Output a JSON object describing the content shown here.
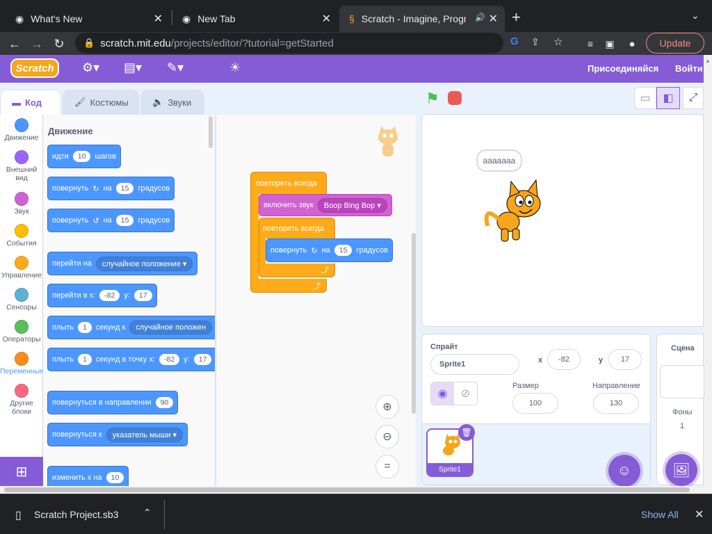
{
  "browser": {
    "tabs": [
      {
        "title": "What's New"
      },
      {
        "title": "New Tab"
      },
      {
        "title": "Scratch - Imagine, Program"
      }
    ],
    "url_host": "scratch.mit.edu",
    "url_path": "/projects/editor/?tutorial=getStarted",
    "update_label": "Update"
  },
  "scratch": {
    "logo": "Scratch",
    "join_label": "Присоединяйся",
    "signin_label": "Войти",
    "tabs": {
      "code": "Код",
      "costumes": "Костюмы",
      "sounds": "Звуки"
    },
    "categories": [
      {
        "label": "Движение",
        "color": "#4c97ff"
      },
      {
        "label": "Внешний вид",
        "color": "#9966ff"
      },
      {
        "label": "Звук",
        "color": "#cf63cf"
      },
      {
        "label": "События",
        "color": "#ffbf00"
      },
      {
        "label": "Управление",
        "color": "#ffab19"
      },
      {
        "label": "Сенсоры",
        "color": "#5cb1d6"
      },
      {
        "label": "Операторы",
        "color": "#59c059"
      },
      {
        "label": "Переменные",
        "color": "#ff8c1a"
      },
      {
        "label": "Другие блоки",
        "color": "#ff6680"
      }
    ],
    "palette": {
      "heading": "Движение",
      "move": {
        "a": "идти",
        "steps": "10",
        "b": "шагов"
      },
      "turn_right": {
        "a": "повернуть",
        "b": "на",
        "deg": "15",
        "c": "градусов"
      },
      "turn_left": {
        "a": "повернуть",
        "b": "на",
        "deg": "15",
        "c": "градусов"
      },
      "goto": {
        "a": "перейти на",
        "dd": "случайное положение"
      },
      "goto_xy": {
        "a": "перейти в x:",
        "x": "-82",
        "b": "y:",
        "y": "17"
      },
      "glide": {
        "a": "плыть",
        "secs": "1",
        "b": "секунд к",
        "dd": "случайное положен"
      },
      "glide_xy": {
        "a": "плыть",
        "secs": "1",
        "b": "секунд в точку x:",
        "x": "-82",
        "c": "y:",
        "y": "17"
      },
      "point_dir": {
        "a": "повернуться в направлении",
        "dir": "90"
      },
      "point_to": {
        "a": "повернуться к",
        "dd": "указатель мыши"
      },
      "change_x": {
        "a": "изменить х на",
        "val": "10"
      }
    },
    "script": {
      "forever1": "повторять всегда",
      "play_sound": "включить звук",
      "sound_name": "Boop Bing Bop",
      "forever2": "повторять всегда",
      "turn": {
        "a": "повернуть",
        "b": "на",
        "deg": "15",
        "c": "градусов"
      }
    },
    "stage": {
      "speech": "aaaaaaa"
    },
    "sprite_info": {
      "sprite_label": "Спрайт",
      "sprite_name": "Sprite1",
      "x_label": "x",
      "x": "-82",
      "y_label": "y",
      "y": "17",
      "size_label": "Размер",
      "size": "100",
      "direction_label": "Направление",
      "direction": "130",
      "thumb_name": "Sprite1"
    },
    "stage_pane": {
      "title": "Сцена",
      "backdrops_label": "Фоны",
      "backdrops_count": "1"
    }
  },
  "downloads": {
    "file": "Scratch Project.sb3",
    "show_all": "Show All"
  }
}
